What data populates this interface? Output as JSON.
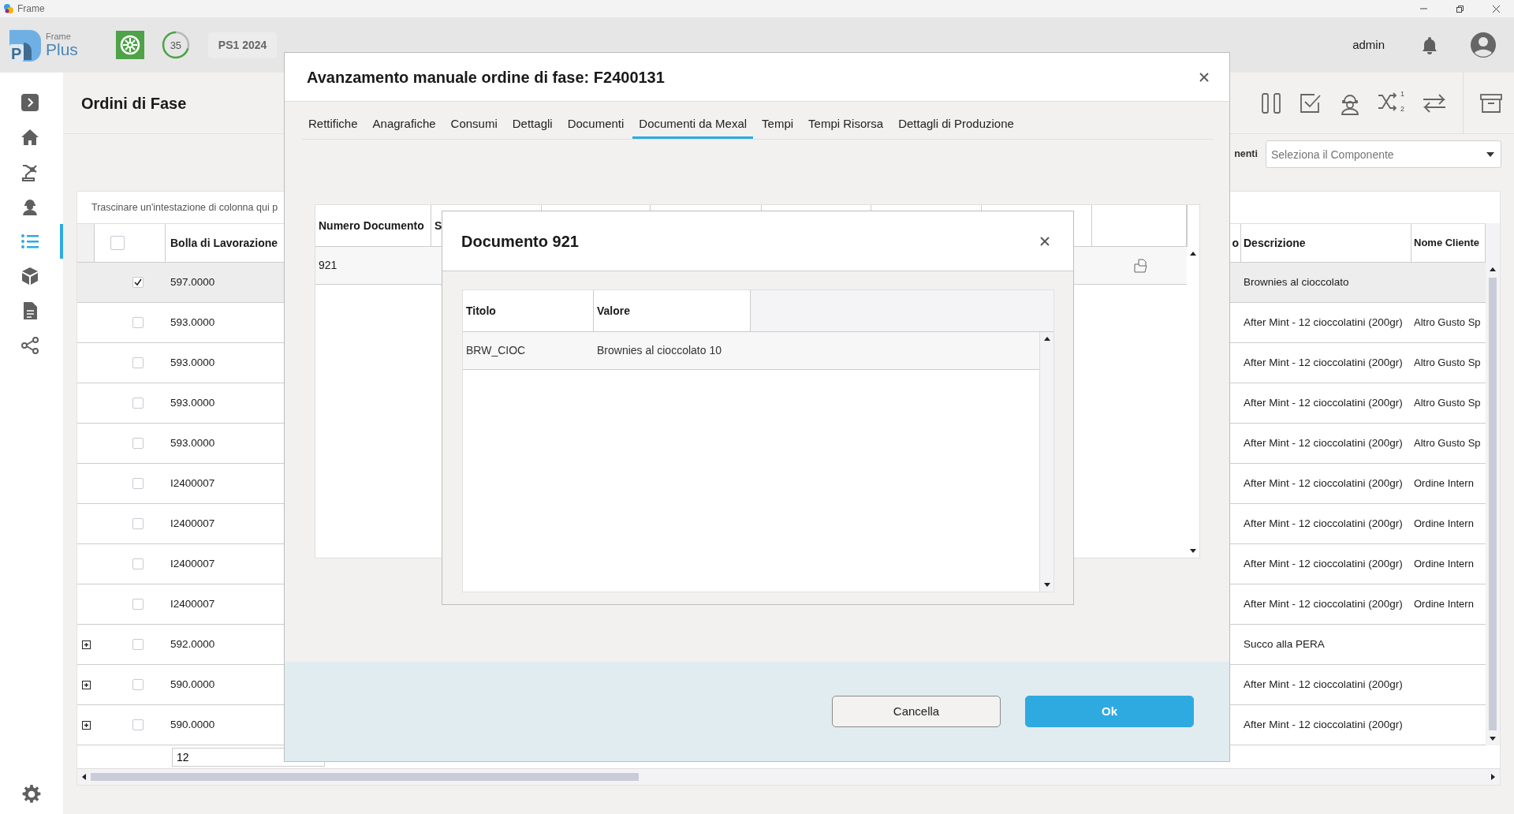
{
  "window": {
    "title": "Frame"
  },
  "header": {
    "logo_letter": "P",
    "brand_small": "Frame",
    "brand": "Plus",
    "counter": {
      "text": "35",
      "level": 0.7
    },
    "period": "PS1 2024",
    "user": "admin"
  },
  "sidebar": {
    "items": [
      {
        "selected": false
      },
      {
        "selected": false
      },
      {
        "selected": false
      },
      {
        "selected": false
      },
      {
        "selected": true
      },
      {
        "selected": false
      },
      {
        "selected": false
      },
      {
        "selected": false
      }
    ]
  },
  "page": {
    "title": "Ordini di Fase",
    "sort_marks": [
      "1",
      "2"
    ],
    "component_label": "nenti",
    "component_placeholder": "Seleziona il Componente"
  },
  "grid": {
    "group_hint": "Trascinare un'intestazione di colonna qui p",
    "all_checked": false,
    "columns": [
      "Bolla di Lavorazione",
      "o",
      "Descrizione",
      "Nome Cliente"
    ],
    "rows": [
      {
        "expandable": false,
        "checked": true,
        "selected": true,
        "bolla": "597.0000",
        "descrizione": "Brownies al cioccolato"
      },
      {
        "expandable": false,
        "checked": false,
        "selected": false,
        "bolla": "593.0000",
        "descrizione": "After Mint - 12 cioccolatini (200gr)",
        "cliente": "Altro Gusto Sp"
      },
      {
        "expandable": false,
        "checked": false,
        "selected": false,
        "bolla": "593.0000",
        "descrizione": "After Mint - 12 cioccolatini (200gr)",
        "cliente": "Altro Gusto Sp"
      },
      {
        "expandable": false,
        "checked": false,
        "selected": false,
        "bolla": "593.0000",
        "descrizione": "After Mint - 12 cioccolatini (200gr)",
        "cliente": "Altro Gusto Sp"
      },
      {
        "expandable": false,
        "checked": false,
        "selected": false,
        "bolla": "593.0000",
        "descrizione": "After Mint - 12 cioccolatini (200gr)",
        "cliente": "Altro Gusto Sp"
      },
      {
        "expandable": false,
        "checked": false,
        "selected": false,
        "bolla": "I2400007",
        "descrizione": "After Mint - 12 cioccolatini (200gr)",
        "cliente": "Ordine Intern"
      },
      {
        "expandable": false,
        "checked": false,
        "selected": false,
        "bolla": "I2400007",
        "descrizione": "After Mint - 12 cioccolatini (200gr)",
        "cliente": "Ordine Intern"
      },
      {
        "expandable": false,
        "checked": false,
        "selected": false,
        "bolla": "I2400007",
        "descrizione": "After Mint - 12 cioccolatini (200gr)",
        "cliente": "Ordine Intern"
      },
      {
        "expandable": false,
        "checked": false,
        "selected": false,
        "bolla": "I2400007",
        "descrizione": "After Mint - 12 cioccolatini (200gr)",
        "cliente": "Ordine Intern"
      },
      {
        "expandable": true,
        "checked": false,
        "selected": false,
        "bolla": "592.0000",
        "descrizione": "Succo alla PERA"
      },
      {
        "expandable": true,
        "checked": false,
        "selected": false,
        "bolla": "590.0000",
        "descrizione": "After Mint - 12 cioccolatini (200gr)"
      },
      {
        "expandable": true,
        "checked": false,
        "selected": false,
        "bolla": "590.0000",
        "descrizione": "After Mint - 12 cioccolatini (200gr)"
      }
    ],
    "footer_value": "12"
  },
  "modal": {
    "title": "Avanzamento manuale ordine di fase: F2400131",
    "tabs": [
      {
        "label": "Rettifiche",
        "selected": false
      },
      {
        "label": "Anagrafiche",
        "selected": false
      },
      {
        "label": "Consumi",
        "selected": false
      },
      {
        "label": "Dettagli",
        "selected": false
      },
      {
        "label": "Documenti",
        "selected": false
      },
      {
        "label": "Documenti da Mexal",
        "selected": true
      },
      {
        "label": "Tempi",
        "selected": false
      },
      {
        "label": "Tempi Risorsa",
        "selected": false
      },
      {
        "label": "Dettagli di Produzione",
        "selected": false
      }
    ],
    "documents": {
      "columns": [
        "Numero Documento",
        "S"
      ],
      "rows": [
        {
          "numero": "921"
        }
      ]
    },
    "buttons": [
      {
        "label": "Cancella",
        "kind": "secondary"
      },
      {
        "label": "Ok",
        "kind": "primary"
      }
    ]
  },
  "dialog": {
    "title": "Documento 921",
    "columns": [
      "Titolo",
      "Valore"
    ],
    "rows": [
      {
        "titolo": "BRW_CIOC",
        "valore": "Brownies al cioccolato 10"
      }
    ]
  }
}
